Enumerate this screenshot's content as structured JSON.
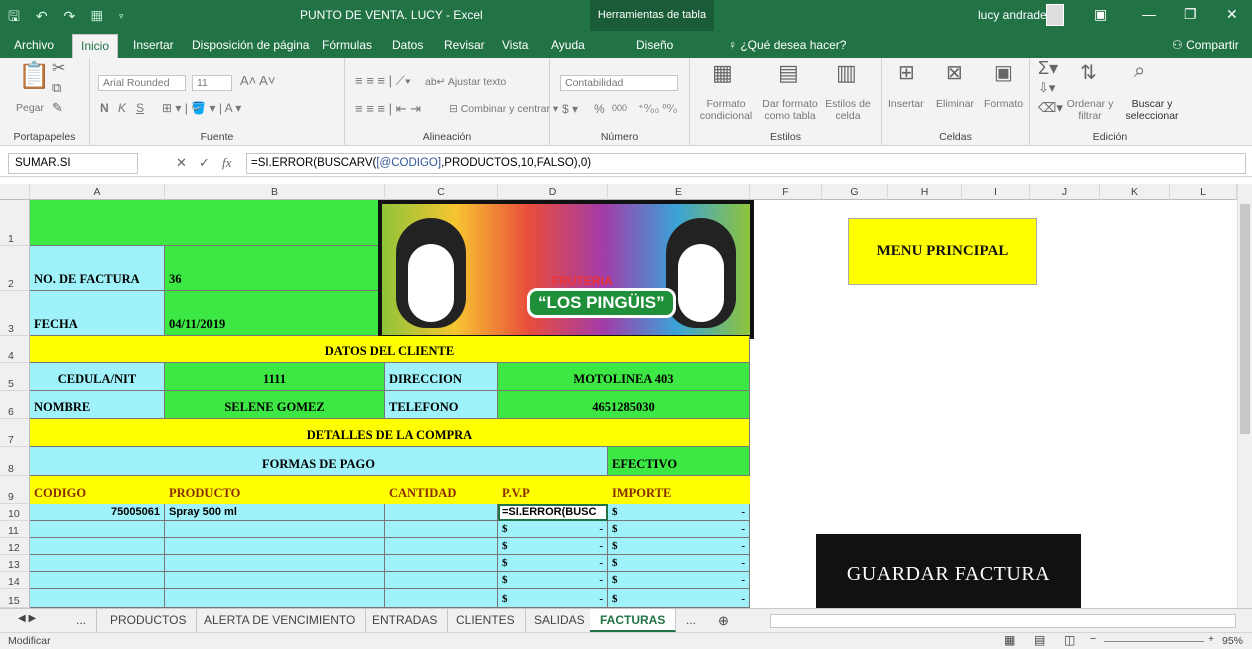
{
  "window": {
    "title": "PUNTO DE VENTA. LUCY  -  Excel",
    "context_tab": "Herramientas de tabla",
    "user": "lucy andrade",
    "qat": "🖫 ↶ ↷ ▦ ▿"
  },
  "ribbon_tabs": [
    "Archivo",
    "Inicio",
    "Insertar",
    "Disposición de página",
    "Fórmulas",
    "Datos",
    "Revisar",
    "Vista",
    "Ayuda",
    "Diseño"
  ],
  "tell_me": "¿Qué desea hacer?",
  "share": "Compartir",
  "groups": {
    "portapapeles": "Portapapeles",
    "fuente": "Fuente",
    "alineacion": "Alineación",
    "numero": "Número",
    "estilos": "Estilos",
    "celdas": "Celdas",
    "edicion": "Edición"
  },
  "ribbon": {
    "pegar": "Pegar",
    "font_name": "Arial Rounded",
    "font_size": "11",
    "bold": "N",
    "italic": "K",
    "underline": "S",
    "ajustar": "Ajustar texto",
    "combinar": "Combinar y centrar",
    "number_format": "Contabilidad",
    "percent": "%",
    "thousands": "000",
    "formato_cond": "Formato condicional",
    "dar_formato": "Dar formato como tabla",
    "estilos_celda": "Estilos de celda",
    "insertar": "Insertar",
    "eliminar": "Eliminar",
    "formato": "Formato",
    "ordenar": "Ordenar y filtrar",
    "buscar": "Buscar y seleccionar"
  },
  "formula_bar": {
    "name_box": "SUMAR.SI",
    "prefix": "=SI.ERROR(BUSCARV(",
    "ref": "[@CODIGO]",
    "suffix": ",PRODUCTOS,10,FALSO),0)"
  },
  "columns": [
    "A",
    "B",
    "C",
    "D",
    "E",
    "F",
    "G",
    "H",
    "I",
    "J",
    "K",
    "L"
  ],
  "rows": [
    "1",
    "2",
    "3",
    "4",
    "5",
    "6",
    "7",
    "8",
    "9",
    "10",
    "11",
    "12",
    "13",
    "14",
    "15"
  ],
  "invoice": {
    "no_factura_label": "NO. DE FACTURA",
    "no_factura": "36",
    "fecha_label": "FECHA",
    "fecha": "04/11/2019",
    "datos_cliente": "DATOS DEL CLIENTE",
    "cedula_label": "CEDULA/NIT",
    "cedula": "1111",
    "direccion_label": "DIRECCION",
    "direccion": "MOTOLINEA 403",
    "nombre_label": "NOMBRE",
    "nombre": "SELENE GOMEZ",
    "telefono_label": "TELEFONO",
    "telefono": "4651285030",
    "detalles": "DETALLES DE LA COMPRA",
    "formas_pago": "FORMAS DE PAGO",
    "forma_pago": "EFECTIVO",
    "headers": [
      "CODIGO",
      "PRODUCTO",
      "CANTIDAD",
      "P.V.P",
      "IMPORTE"
    ],
    "row10": {
      "codigo": "75005061",
      "producto": "Spray 500 ml",
      "pvp_edit": "=SI.ERROR(BUSC"
    },
    "currency": "$",
    "dash": "-"
  },
  "logo": {
    "line1": "FRUTERIA",
    "line2": "“LOS PINGÜIS”"
  },
  "buttons": {
    "menu": "MENU PRINCIPAL",
    "guardar": "GUARDAR FACTURA"
  },
  "sheet_tabs": [
    "...",
    "PRODUCTOS",
    "ALERTA DE VENCIMIENTO",
    "ENTRADAS",
    "CLIENTES",
    "SALIDAS",
    "FACTURAS",
    "..."
  ],
  "status": {
    "mode": "Modificar",
    "zoom": "95%"
  },
  "colors": {
    "excel_green": "#217346",
    "cell_green": "#3ee844",
    "cell_cyan": "#9ff2f9",
    "cell_yellow": "#ffff00"
  }
}
